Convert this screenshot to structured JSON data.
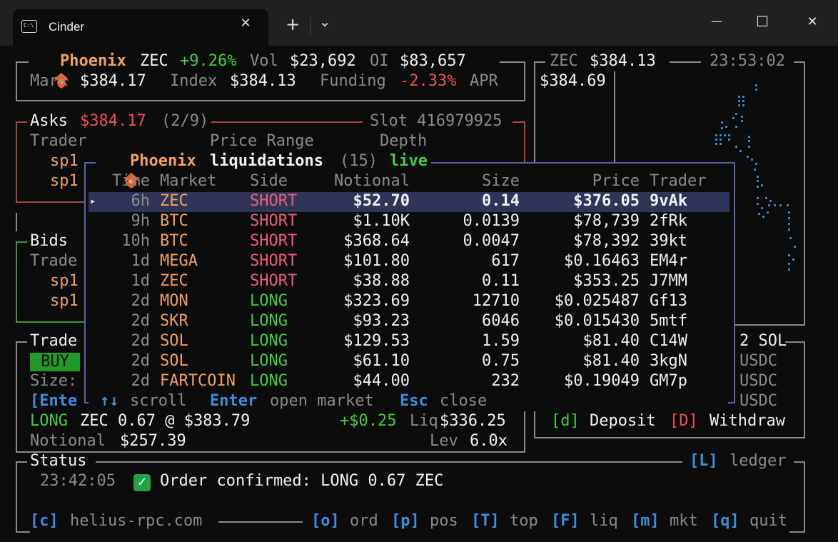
{
  "window": {
    "tab_title": "Cinder",
    "tab_icon": "terminal-icon",
    "new_tab": "+",
    "dropdown": "⌄",
    "minimize": "—",
    "maximize": "☐",
    "close": "✕",
    "tab_close": "✕"
  },
  "header": {
    "brand": "Phoenix",
    "market": "ZEC",
    "change": "+9.26%",
    "vol_label": "Vol",
    "vol": "$23,692",
    "oi_label": "OI",
    "oi": "$83,657",
    "mark_label": "Mark",
    "mark": "$384.17",
    "index_label": "Index",
    "index": "$384.13",
    "funding_label": "Funding",
    "funding": "-2.33%",
    "funding_unit": "APR"
  },
  "chart_panel": {
    "symbol": "ZEC",
    "price": "$384.13",
    "time": "23:53:02",
    "axis_top": "$384.69"
  },
  "asks": {
    "title": "Asks",
    "price": "$384.17",
    "count": "(2/9)",
    "slot": "Slot 416979925",
    "col_trader": "Trader",
    "col_range": "Price Range",
    "col_depth": "Depth",
    "rows": [
      "sp1",
      "sp1"
    ]
  },
  "bids": {
    "title": "Bids",
    "col_trader": "Trade",
    "rows": [
      "sp1",
      "sp1"
    ]
  },
  "trade": {
    "title": "Trade",
    "buy": "BUY",
    "size_label": "Size:",
    "enter_hint": "[Ente",
    "right_line1": "2 SOL",
    "right_line2": "USDC",
    "right_line3": "USDC",
    "right_line4": "USDC",
    "position_side": "LONG",
    "position_text": "ZEC 0.67 @ $383.79",
    "pnl": "+$0.25",
    "liq_label": "Liq",
    "liq": "$336.25",
    "notional_label": "Notional",
    "notional": "$257.39",
    "lev_label": "Lev",
    "lev": "6.0x"
  },
  "account": {
    "deposit_key": "[d]",
    "deposit": "Deposit",
    "withdraw_key": "[D]",
    "withdraw": "Withdraw"
  },
  "liquidations": {
    "brand": "Phoenix",
    "title": "liquidations",
    "count": "(15)",
    "status": "live",
    "headers": [
      "Time",
      "Market",
      "Side",
      "Notional",
      "Size",
      "Price",
      "Trader"
    ],
    "rows": [
      {
        "time": "6h",
        "market": "ZEC",
        "side": "SHORT",
        "notional": "$52.70",
        "size": "0.14",
        "price": "$376.05",
        "trader": "9vAk"
      },
      {
        "time": "9h",
        "market": "BTC",
        "side": "SHORT",
        "notional": "$1.10K",
        "size": "0.0139",
        "price": "$78,739",
        "trader": "2fRk"
      },
      {
        "time": "10h",
        "market": "BTC",
        "side": "SHORT",
        "notional": "$368.64",
        "size": "0.0047",
        "price": "$78,392",
        "trader": "39kt"
      },
      {
        "time": "1d",
        "market": "MEGA",
        "side": "SHORT",
        "notional": "$101.80",
        "size": "617",
        "price": "$0.16463",
        "trader": "EM4r"
      },
      {
        "time": "1d",
        "market": "ZEC",
        "side": "SHORT",
        "notional": "$38.88",
        "size": "0.11",
        "price": "$353.25",
        "trader": "J7MM"
      },
      {
        "time": "2d",
        "market": "MON",
        "side": "LONG",
        "notional": "$323.69",
        "size": "12710",
        "price": "$0.025487",
        "trader": "Gf13"
      },
      {
        "time": "2d",
        "market": "SKR",
        "side": "LONG",
        "notional": "$93.23",
        "size": "6046",
        "price": "$0.015430",
        "trader": "5mtf"
      },
      {
        "time": "2d",
        "market": "SOL",
        "side": "LONG",
        "notional": "$129.53",
        "size": "1.59",
        "price": "$81.40",
        "trader": "C14W"
      },
      {
        "time": "2d",
        "market": "SOL",
        "side": "LONG",
        "notional": "$61.10",
        "size": "0.75",
        "price": "$81.40",
        "trader": "3kgN"
      },
      {
        "time": "2d",
        "market": "FARTCOIN",
        "side": "LONG",
        "notional": "$44.00",
        "size": "232",
        "price": "$0.19049",
        "trader": "GM7p"
      }
    ],
    "selected_marker": "▸",
    "hint_scroll_key": "↑↓",
    "hint_scroll": "scroll",
    "hint_enter_key": "Enter",
    "hint_enter": "open market",
    "hint_esc_key": "Esc",
    "hint_esc": "close"
  },
  "status": {
    "title": "Status",
    "ledger_key": "[L]",
    "ledger": "ledger",
    "time": "23:42:05",
    "message": "Order confirmed: LONG 0.67 ZEC"
  },
  "footer": {
    "rpc_key": "[c]",
    "rpc": "helius-rpc.com",
    "keys": [
      {
        "key": "[o]",
        "label": "ord"
      },
      {
        "key": "[p]",
        "label": "pos"
      },
      {
        "key": "[T]",
        "label": "top"
      },
      {
        "key": "[F]",
        "label": "liq"
      },
      {
        "key": "[m]",
        "label": "mkt"
      },
      {
        "key": "[q]",
        "label": "quit"
      }
    ]
  },
  "colors": {
    "green": "#3fcf3f",
    "red": "#f05050",
    "orange": "#f0a060",
    "blue": "#3b8ede",
    "highlight": "#2f3559"
  }
}
